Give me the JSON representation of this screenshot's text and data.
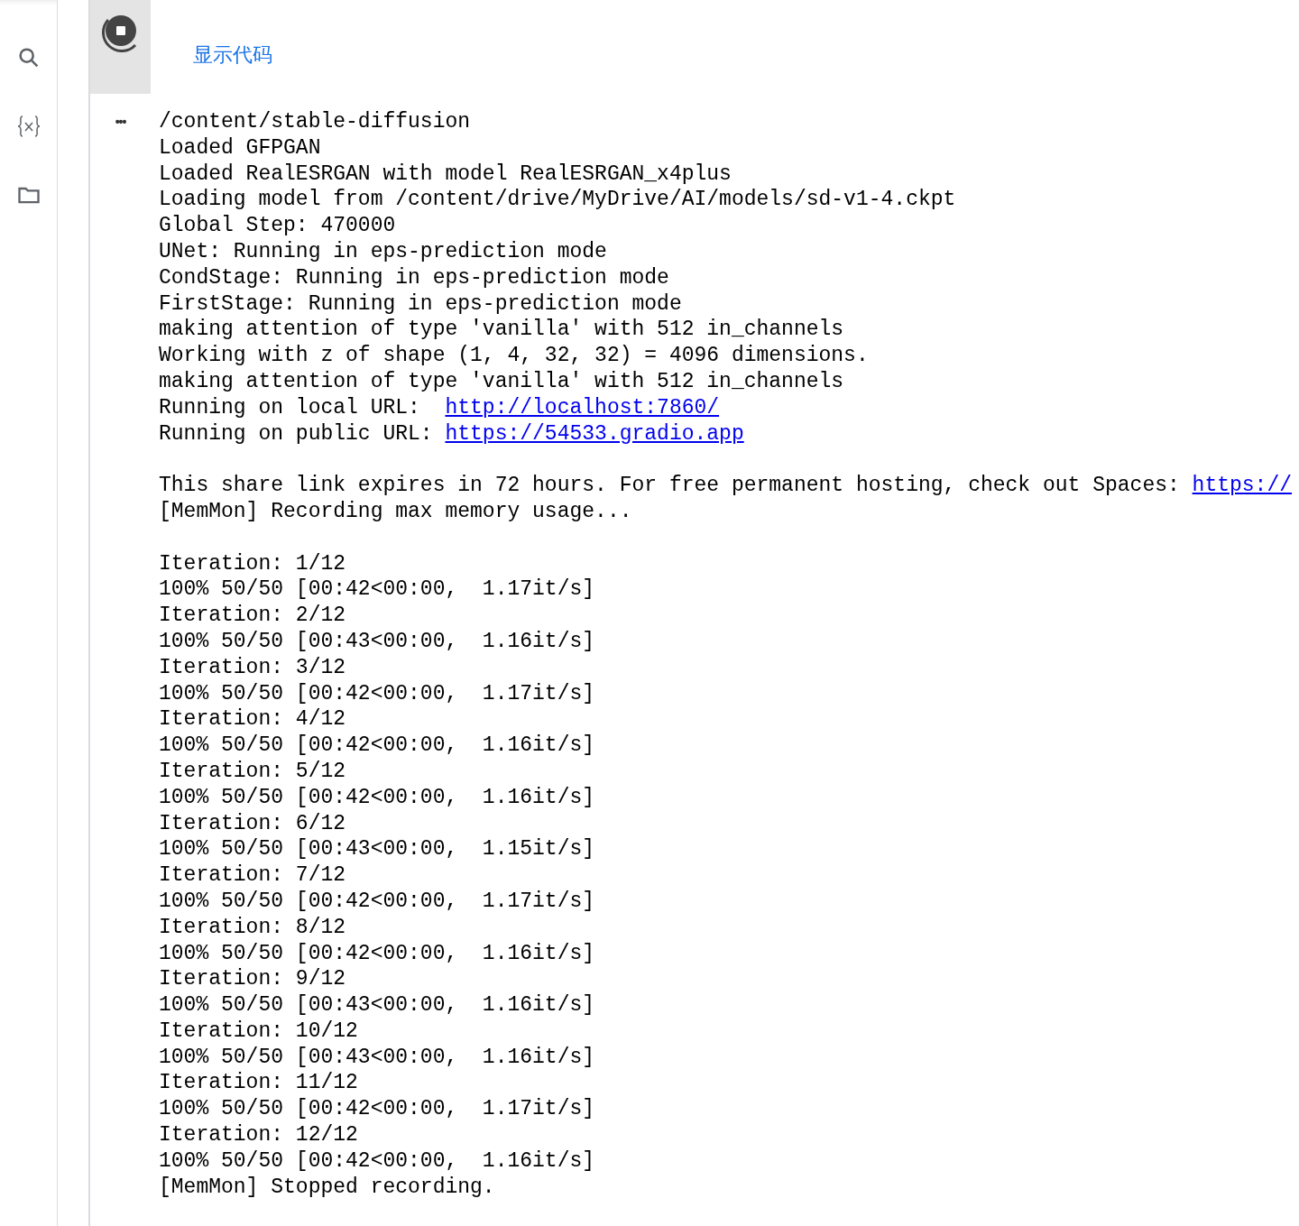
{
  "sidebar": {
    "items": [
      {
        "kind": "search"
      },
      {
        "kind": "variables"
      },
      {
        "kind": "files"
      }
    ]
  },
  "cell": {
    "running": true,
    "show_code_link": "显示代码",
    "output_menu": "•••"
  },
  "output": {
    "lines": [
      {
        "kind": "text",
        "text": "/content/stable-diffusion"
      },
      {
        "kind": "text",
        "text": "Loaded GFPGAN"
      },
      {
        "kind": "text",
        "text": "Loaded RealESRGAN with model RealESRGAN_x4plus"
      },
      {
        "kind": "text",
        "text": "Loading model from /content/drive/MyDrive/AI/models/sd-v1-4.ckpt"
      },
      {
        "kind": "text",
        "text": "Global Step: 470000"
      },
      {
        "kind": "text",
        "text": "UNet: Running in eps-prediction mode"
      },
      {
        "kind": "text",
        "text": "CondStage: Running in eps-prediction mode"
      },
      {
        "kind": "text",
        "text": "FirstStage: Running in eps-prediction mode"
      },
      {
        "kind": "text",
        "text": "making attention of type 'vanilla' with 512 in_channels"
      },
      {
        "kind": "text",
        "text": "Working with z of shape (1, 4, 32, 32) = 4096 dimensions."
      },
      {
        "kind": "text",
        "text": "making attention of type 'vanilla' with 512 in_channels"
      },
      {
        "kind": "text",
        "text": "Running on local URL:  ",
        "link": "http://localhost:7860/"
      },
      {
        "kind": "text",
        "text": "Running on public URL: ",
        "link": "https://54533.gradio.app"
      },
      {
        "kind": "blank"
      },
      {
        "kind": "text",
        "text": "This share link expires in 72 hours. For free permanent hosting, check out Spaces: ",
        "link": "https://"
      },
      {
        "kind": "text",
        "text": "[MemMon] Recording max memory usage..."
      },
      {
        "kind": "blank"
      },
      {
        "kind": "text",
        "text": "Iteration: 1/12"
      },
      {
        "kind": "text",
        "text": "100% 50/50 [00:42<00:00,  1.17it/s]"
      },
      {
        "kind": "text",
        "text": "Iteration: 2/12"
      },
      {
        "kind": "text",
        "text": "100% 50/50 [00:43<00:00,  1.16it/s]"
      },
      {
        "kind": "text",
        "text": "Iteration: 3/12"
      },
      {
        "kind": "text",
        "text": "100% 50/50 [00:42<00:00,  1.17it/s]"
      },
      {
        "kind": "text",
        "text": "Iteration: 4/12"
      },
      {
        "kind": "text",
        "text": "100% 50/50 [00:42<00:00,  1.16it/s]"
      },
      {
        "kind": "text",
        "text": "Iteration: 5/12"
      },
      {
        "kind": "text",
        "text": "100% 50/50 [00:42<00:00,  1.16it/s]"
      },
      {
        "kind": "text",
        "text": "Iteration: 6/12"
      },
      {
        "kind": "text",
        "text": "100% 50/50 [00:43<00:00,  1.15it/s]"
      },
      {
        "kind": "text",
        "text": "Iteration: 7/12"
      },
      {
        "kind": "text",
        "text": "100% 50/50 [00:42<00:00,  1.17it/s]"
      },
      {
        "kind": "text",
        "text": "Iteration: 8/12"
      },
      {
        "kind": "text",
        "text": "100% 50/50 [00:42<00:00,  1.16it/s]"
      },
      {
        "kind": "text",
        "text": "Iteration: 9/12"
      },
      {
        "kind": "text",
        "text": "100% 50/50 [00:43<00:00,  1.16it/s]"
      },
      {
        "kind": "text",
        "text": "Iteration: 10/12"
      },
      {
        "kind": "text",
        "text": "100% 50/50 [00:43<00:00,  1.16it/s]"
      },
      {
        "kind": "text",
        "text": "Iteration: 11/12"
      },
      {
        "kind": "text",
        "text": "100% 50/50 [00:42<00:00,  1.17it/s]"
      },
      {
        "kind": "text",
        "text": "Iteration: 12/12"
      },
      {
        "kind": "text",
        "text": "100% 50/50 [00:42<00:00,  1.16it/s]"
      },
      {
        "kind": "text",
        "text": "[MemMon] Stopped recording."
      }
    ]
  }
}
